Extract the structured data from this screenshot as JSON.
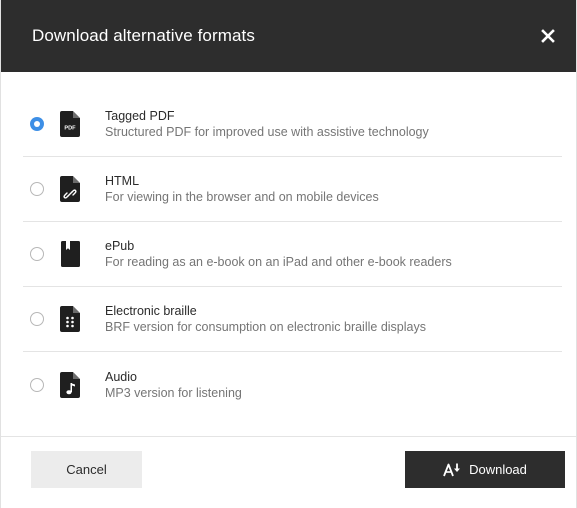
{
  "dialog": {
    "title": "Download alternative formats",
    "close_icon": "close-icon"
  },
  "options": [
    {
      "id": "tagged-pdf",
      "title": "Tagged PDF",
      "description": "Structured PDF for improved use with assistive technology",
      "icon": "pdf-file-icon",
      "icon_text": "PDF",
      "selected": true
    },
    {
      "id": "html",
      "title": "HTML",
      "description": "For viewing in the browser and on mobile devices",
      "icon": "html-file-icon",
      "selected": false
    },
    {
      "id": "epub",
      "title": "ePub",
      "description": "For reading as an e-book on an iPad and other e-book readers",
      "icon": "epub-book-icon",
      "selected": false
    },
    {
      "id": "braille",
      "title": "Electronic braille",
      "description": "BRF version for consumption on electronic braille displays",
      "icon": "braille-file-icon",
      "selected": false
    },
    {
      "id": "audio",
      "title": "Audio",
      "description": "MP3 version for listening",
      "icon": "audio-file-icon",
      "selected": false
    }
  ],
  "footer": {
    "cancel_label": "Cancel",
    "download_label": "Download",
    "download_icon": "download-icon"
  },
  "colors": {
    "header_bg": "#2d2d2d",
    "radio_selected": "#3d8fe6"
  }
}
